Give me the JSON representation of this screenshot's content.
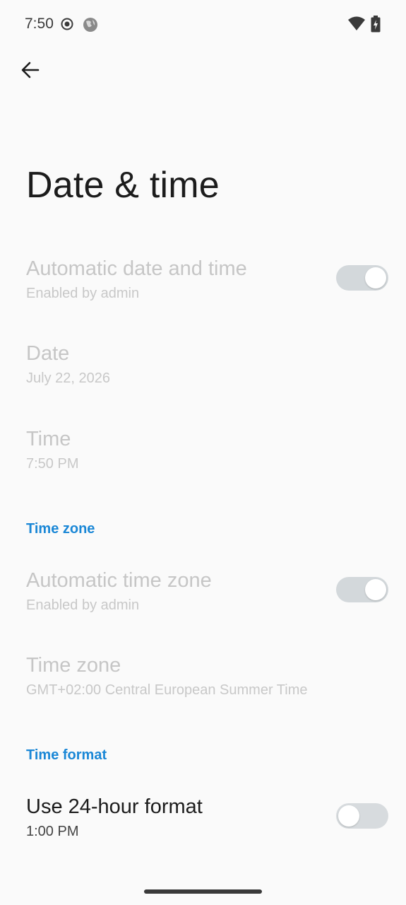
{
  "status_bar": {
    "time": "7:50",
    "icons_left": [
      "record-icon",
      "globe-icon"
    ],
    "icons_right": [
      "wifi-icon",
      "battery-charging-icon"
    ]
  },
  "header": {
    "back_icon": "arrow-left-icon",
    "title": "Date & time"
  },
  "settings": {
    "auto_datetime": {
      "title": "Automatic date and time",
      "subtitle": "Enabled by admin",
      "toggle_on": true,
      "disabled": true
    },
    "date": {
      "title": "Date",
      "subtitle": "July 22, 2026",
      "disabled": true
    },
    "time": {
      "title": "Time",
      "subtitle": "7:50 PM",
      "disabled": true
    },
    "section_time_zone": "Time zone",
    "auto_timezone": {
      "title": "Automatic time zone",
      "subtitle": "Enabled by admin",
      "toggle_on": true,
      "disabled": true
    },
    "timezone": {
      "title": "Time zone",
      "subtitle": "GMT+02:00 Central European Summer Time",
      "disabled": true
    },
    "section_time_format": "Time format",
    "use_24h": {
      "title": "Use 24-hour format",
      "subtitle": "1:00 PM",
      "toggle_on": false,
      "disabled": false
    }
  },
  "colors": {
    "accent": "#1a87d6",
    "disabled_text": "#c6c6c6",
    "toggle_track": "#d3d8db",
    "background": "#fafafa"
  }
}
